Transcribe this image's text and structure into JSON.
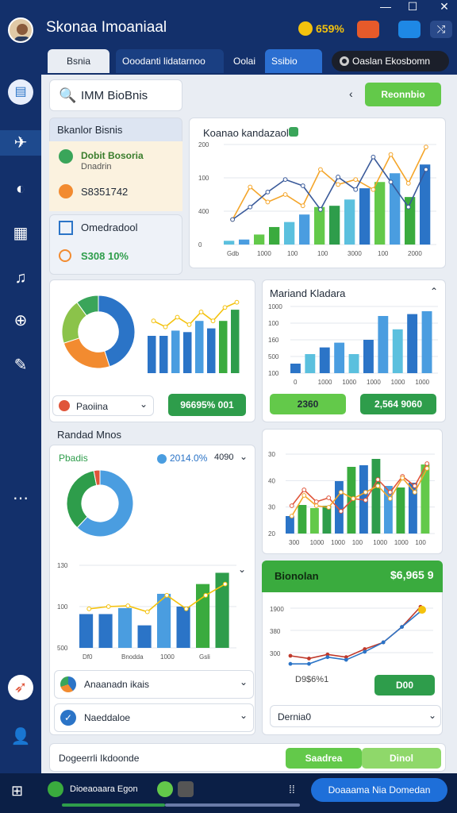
{
  "app": {
    "title": "Skonaa Imoaniaal",
    "coins": "659%"
  },
  "tabs": [
    {
      "label": "Bsnia"
    },
    {
      "label": "Ooodanti lidatarnoo"
    },
    {
      "label": "Oolai"
    },
    {
      "label": "Ssibio"
    },
    {
      "label": "Oaslan Ekosbomn"
    }
  ],
  "search": {
    "value": "IMM BioBnis"
  },
  "header_btn": {
    "label": "Reonnbio"
  },
  "left_panel": {
    "title": "Bkanlor Bisnis",
    "item1_title": "Dobit Bosoria",
    "item1_sub": "Dnadrin",
    "item2_value": "S8351742",
    "box2_title": "Omedradool",
    "box2_value": "S308 10%"
  },
  "chart1": {
    "title": "Koanao kandazaol",
    "chart_data": {
      "type": "bar",
      "y_ticks": [
        "200",
        "100",
        "400",
        "0"
      ],
      "x_ticks": [
        "Gdb",
        "1000",
        "100",
        "100",
        "3000",
        "100",
        "2000"
      ],
      "bars": [
        3,
        4,
        8,
        14,
        18,
        24,
        30,
        31,
        36,
        45,
        50,
        57,
        38,
        64
      ],
      "line_a": [
        20,
        46,
        34,
        40,
        31,
        60,
        48,
        52,
        44,
        72,
        49,
        78
      ],
      "line_b": [
        20,
        30,
        42,
        52,
        47,
        28,
        54,
        44,
        70,
        50,
        30,
        60
      ]
    }
  },
  "donut1": {
    "dropdown_label": "Paoiina",
    "chart_data": {
      "type": "pie",
      "slices": [
        45,
        25,
        20,
        10
      ],
      "colors": [
        "#2b74c7",
        "#f28b30",
        "#8bc34a",
        "#3aa55a"
      ]
    }
  },
  "bars2": {
    "value_btn": "96695% 001",
    "chart_data": {
      "type": "bar",
      "bars": [
        50,
        50,
        57,
        55,
        70,
        60,
        70,
        85
      ],
      "line": [
        70,
        62,
        75,
        65,
        82,
        70,
        88,
        95
      ]
    }
  },
  "chart3": {
    "title": "Mariand Kladara",
    "y_ticks": [
      "1000",
      "100",
      "160",
      "500",
      "100"
    ],
    "x_ticks": [
      "0",
      "1000",
      "1000",
      "1000",
      "1000",
      "1000"
    ],
    "chart_data": {
      "type": "bar",
      "bars": [
        10,
        20,
        27,
        32,
        20,
        35,
        60,
        46,
        62,
        65
      ]
    },
    "btn1": "2360",
    "btn2": "2,564 9060"
  },
  "section": {
    "title": "Randad Mnos",
    "legend_label": "Pbadis",
    "legend_pct": "2014.0%",
    "legend_val": "4090"
  },
  "donut2": {
    "chart_data": {
      "type": "pie",
      "slices": [
        62,
        35,
        3
      ],
      "colors": [
        "#4a9de0",
        "#2e9d4b",
        "#e0553a"
      ]
    }
  },
  "chart4": {
    "y_ticks": [
      "30",
      "40",
      "30",
      "20"
    ],
    "x_ticks": [
      "300",
      "1000",
      "1000",
      "100",
      "1000",
      "1000",
      "100"
    ],
    "chart_data": {
      "type": "bar",
      "bars": [
        22,
        36,
        32,
        35,
        66,
        84,
        86,
        94,
        60,
        58,
        64,
        87
      ],
      "line_a": [
        35,
        55,
        40,
        45,
        28,
        44,
        42,
        68,
        52,
        72,
        60,
        88
      ],
      "line_b": [
        22,
        48,
        35,
        33,
        52,
        44,
        52,
        60,
        44,
        70,
        52,
        82
      ]
    }
  },
  "chart5": {
    "y_ticks": [
      "130",
      "100",
      "500"
    ],
    "x_ticks": [
      "Df0",
      "Bnodda",
      "1000",
      "Gsli"
    ],
    "chart_data": {
      "type": "bar",
      "bars": [
        45,
        45,
        53,
        30,
        72,
        55,
        85,
        100
      ],
      "line": [
        52,
        55,
        56,
        48,
        70,
        52,
        70,
        85
      ]
    }
  },
  "growth_card": {
    "title": "Bionolan",
    "value": "$6,965 9",
    "y_ticks": [
      "1900",
      "380",
      "300"
    ],
    "annotation": "D9$6%1",
    "btn": "D00",
    "dropdown": "Dernia0",
    "chart_data": {
      "type": "line",
      "line_a": [
        52,
        48,
        54,
        50,
        62,
        72,
        95,
        125
      ],
      "line_b": [
        40,
        40,
        50,
        46,
        58,
        72,
        95,
        118
      ],
      "dot": "#f4c20d"
    }
  },
  "dropdowns": {
    "a": "Anaanadn ikais",
    "b": "Naeddaloe"
  },
  "footer": {
    "title": "Dogeerrli Ikdoonde",
    "btn1": "Saadrea",
    "btn2": "Dinol"
  },
  "taskbar": {
    "item1": "Dioeaoaara Egon",
    "cta": "Doaaama Nia Domedan"
  },
  "colors": {
    "navy": "#13306b",
    "accent": "#2e9d4b",
    "lightgreen": "#63c94a",
    "blue": "#2b74c7"
  }
}
